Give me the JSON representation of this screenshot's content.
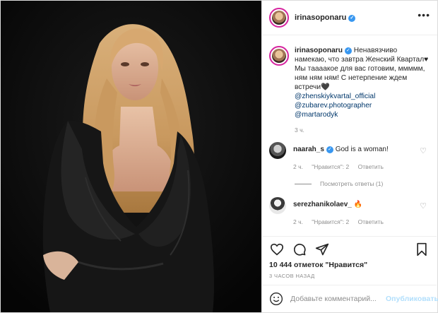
{
  "colors": {
    "accent": "#3897f0",
    "muted": "#8e8e8e",
    "link": "#00376b",
    "publish_disabled": "#b2dffc"
  },
  "header": {
    "username": "irinasoponaru",
    "more_icon": "ellipsis-icon"
  },
  "caption": {
    "username": "irinasoponaru",
    "text": "Ненавязчиво намекаю, что завтра Женский Квартал♥ Мы таааакое для вас готовим, ммммм, ням ням ням! С нетерпение ждем встречи🖤",
    "mentions": [
      "@zhenskiykvartal_official",
      "@zubarev.photographer",
      "@martarodyk"
    ],
    "time": "3 ч."
  },
  "comments": [
    {
      "username": "naarah_s",
      "verified": true,
      "text": "God is a woman!",
      "time": "2 ч.",
      "likes": "\"Нравится\": 2",
      "reply": "Ответить",
      "view_replies": "Посмотреть ответы (1)"
    },
    {
      "username": "serezhanikolaev_",
      "verified": false,
      "text": "🔥",
      "time": "2 ч.",
      "likes": "\"Нравится\": 2",
      "reply": "Ответить"
    }
  ],
  "likes": "10 444 отметок \"Нравится\"",
  "posted": "3 ЧАСОВ НАЗАД",
  "add_comment": {
    "placeholder": "Добавьте комментарий...",
    "publish": "Опубликовать"
  }
}
